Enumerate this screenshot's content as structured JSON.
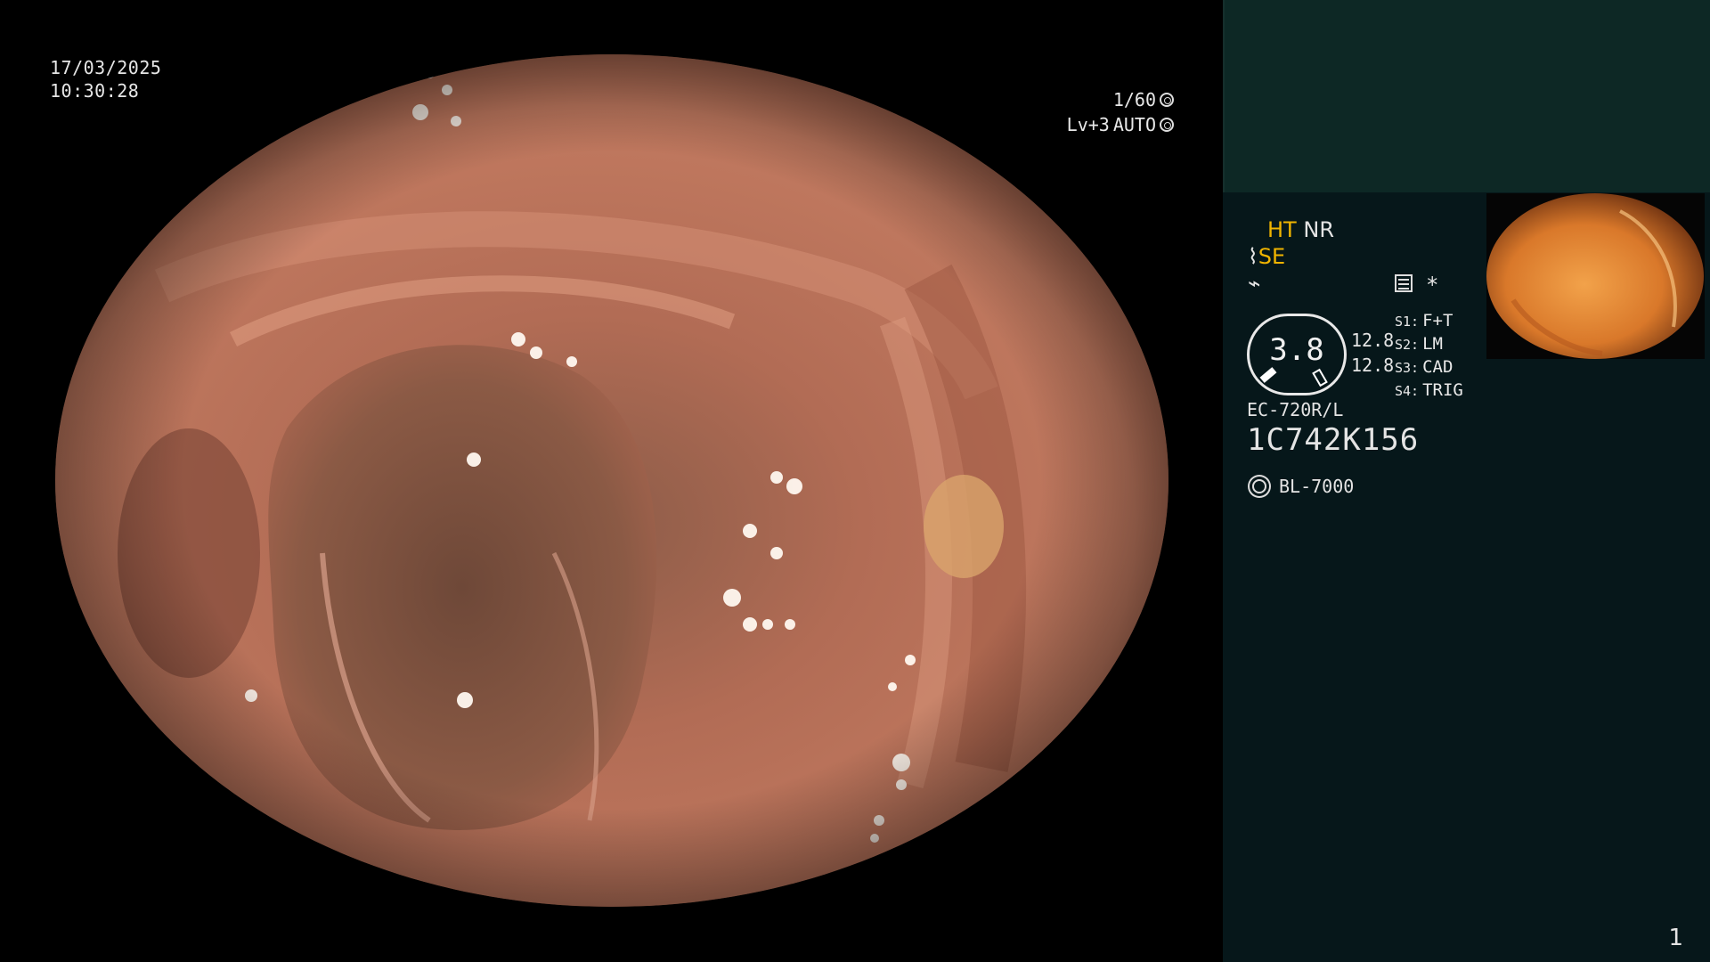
{
  "osd": {
    "date": "17/03/2025",
    "time": "10:30:28",
    "shutter": "1/60",
    "level": "Lv+3",
    "mode": "AUTO"
  },
  "panel": {
    "ht": "HT",
    "nr": "NR",
    "se": "SE",
    "se_prefix": "⌇",
    "bolt": "⌁",
    "star": "*",
    "gauge_value": "3.8",
    "num1": "12.8",
    "num2": "12.8",
    "switches": [
      {
        "key": "S1:",
        "value": "F+T"
      },
      {
        "key": "S2:",
        "value": "LM"
      },
      {
        "key": "S3:",
        "value": "CAD"
      },
      {
        "key": "S4:",
        "value": "TRIG"
      }
    ],
    "model": "EC-720R/L",
    "serial": "1C742K156",
    "light_source": "BL-7000",
    "page_number": "1"
  },
  "colors": {
    "panel_top": "#0d2825",
    "panel_bottom": "#06171a",
    "accent_yellow": "#f0b400",
    "mucosa": "#c57a5d"
  },
  "icons": [
    "shutter-icon",
    "auto-exposure-icon",
    "scope-icon",
    "bolt-icon",
    "stats-icon",
    "gauge-icon",
    "light-source-icon"
  ]
}
